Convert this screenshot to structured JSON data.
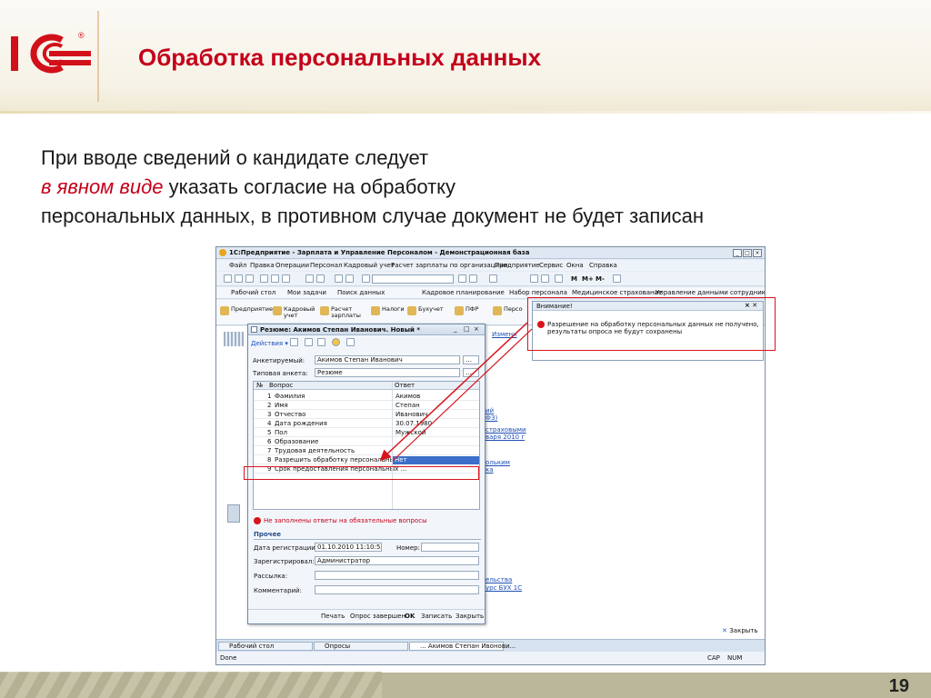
{
  "slide": {
    "title": "Обработка персональных данных",
    "text_line1": "При вводе сведений о кандидате следует",
    "text_line2_em": "в явном виде",
    "text_line2_rest": " указать согласие на обработку",
    "text_line3": "персональных данных, в противном случае документ не будет записан",
    "page_number": "19",
    "logo_text": "1С",
    "logo_reg": "®"
  },
  "colors": {
    "accent": "#c4001a",
    "logo_red": "#d2101a",
    "footer": "#bbb79a"
  },
  "app": {
    "title": "1С:Предприятие - Зарплата и Управление Персоналом - Демонстрационная база",
    "menu": [
      "Файл",
      "Правка",
      "Операции",
      "Персонал",
      "Кадровый учет",
      "Расчет зарплаты по организациям",
      "Предприятие",
      "Сервис",
      "Окна",
      "Справка"
    ],
    "toolbar_extra": [
      "M",
      "M+",
      "M-"
    ],
    "quick": [
      "Рабочий стол",
      "Мои задачи",
      "Поиск данных",
      "Кадровое планирование",
      "Набор персонала",
      "Медицинское страхование",
      "Управление данными сотрудника"
    ],
    "sections": [
      "Предприятие",
      "Кадровый учет",
      "Расчет зарплаты",
      "Налоги",
      "Бухучет",
      "ПФР",
      "Персо"
    ],
    "links": [
      "Измени",
      "ий",
      "ФЗ)",
      "страховыми",
      "варя 2010 г",
      "ольким",
      "ка",
      "ельства",
      "урс БУХ 1С"
    ],
    "close_label": "Закрыть",
    "taskbar": [
      "Рабочий стол",
      "Опросы",
      "... Акимов Степан Ивонови..."
    ],
    "status_left": "Done",
    "status_right": [
      "CAP",
      "NUM"
    ]
  },
  "doc": {
    "title": "Резюме: Акимов Степан Иванович. Новый *",
    "actions": "Действия",
    "fields": {
      "person_label": "Анкетируемый:",
      "person_value": "Акимов Степан Иванович",
      "template_label": "Типовая анкета:",
      "template_value": "Резюме"
    },
    "table_headers": [
      "№",
      "Вопрос",
      "Ответ"
    ],
    "rows": [
      {
        "n": "1",
        "q": "Фамилия",
        "a": "Акимов"
      },
      {
        "n": "2",
        "q": "Имя",
        "a": "Степан"
      },
      {
        "n": "3",
        "q": "Отчество",
        "a": "Иванович"
      },
      {
        "n": "4",
        "q": "Дата рождения",
        "a": "30.07.1980"
      },
      {
        "n": "5",
        "q": "Пол",
        "a": "Мужской"
      },
      {
        "n": "6",
        "q": "Образование",
        "a": ""
      },
      {
        "n": "7",
        "q": "Трудовая деятельность",
        "a": ""
      },
      {
        "n": "8",
        "q": "Разрешить обработку персональных",
        "a": "Нет"
      },
      {
        "n": "9",
        "q": "Срок предоставления персональных ...",
        "a": ""
      }
    ],
    "error": "Не заполнены ответы на обязательные вопросы",
    "other_section": "Прочее",
    "reg_date_label": "Дата регистрации:",
    "reg_date_value": "01.10.2010 11:10:52",
    "number_label": "Номер:",
    "registered_label": "Зарегистрировал:",
    "registered_value": "Администратор",
    "mailing_label": "Рассылка:",
    "comment_label": "Комментарий:",
    "buttons": [
      "Печать",
      "Опрос завершен",
      "OK",
      "Записать",
      "Закрыть"
    ]
  },
  "warning": {
    "title": "Внимание!",
    "line1": "Разрешение на обработку персональных данных не получено,",
    "line2": "результаты опроса не будут сохранены"
  }
}
